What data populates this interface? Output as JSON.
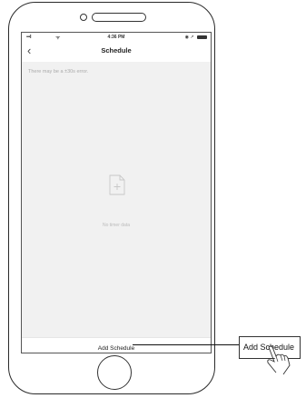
{
  "status_bar": {
    "signal": "•••ll",
    "wifi": "ᯤ",
    "time": "4:36 PM",
    "right_icons": "◉ ↗"
  },
  "nav": {
    "back_icon": "chevron-left",
    "title": "Schedule"
  },
  "hint": "There may be a ±30s error.",
  "empty_state": {
    "icon": "add-file-icon",
    "text": "No timer data"
  },
  "add_button_label": "Add Schedule",
  "callout": {
    "label": "Add Schedule",
    "icon": "tap-hand-icon"
  },
  "colors": {
    "screen_bg": "#f1f1f1",
    "line": "#111111"
  }
}
